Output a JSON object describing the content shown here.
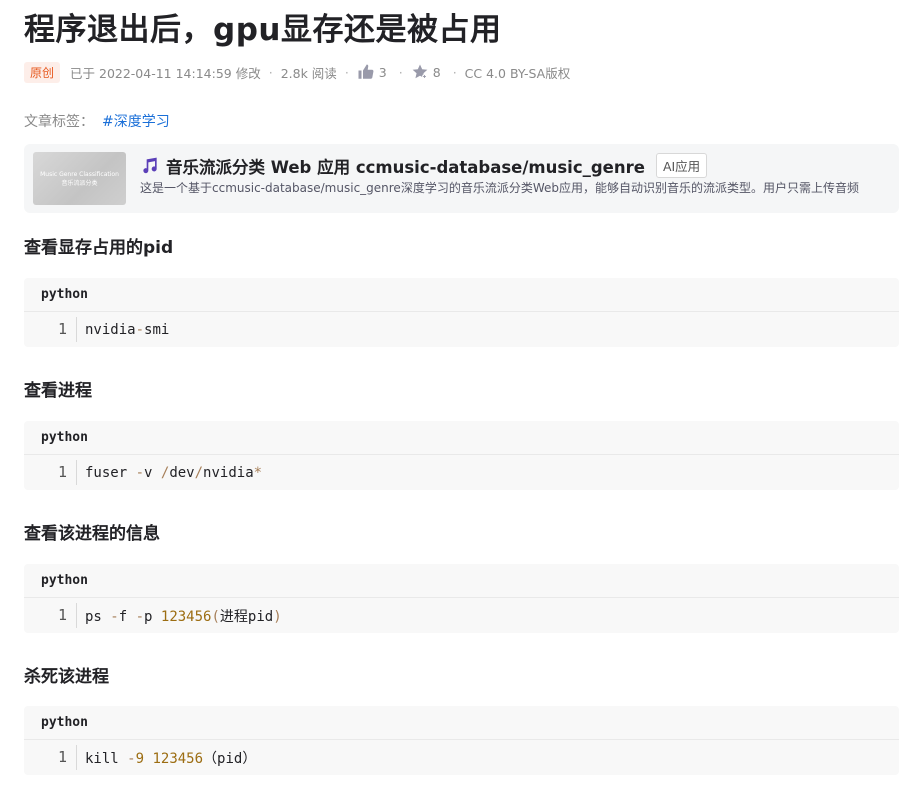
{
  "article": {
    "title": "程序退出后，gpu显存还是被占用",
    "meta": {
      "badge": "原创",
      "modified": "已于 2022-04-11 14:14:59 修改",
      "views": "2.8k 阅读",
      "likes": "3",
      "favorites": "8",
      "license": "CC 4.0 BY-SA版权"
    },
    "tags_label": "文章标签：",
    "tags": [
      "#深度学习"
    ]
  },
  "promo_card": {
    "thumb_text": [
      "Music Genre Classification",
      "音乐流派分类"
    ],
    "title": "音乐流派分类 Web 应用 ccmusic-database/music_genre",
    "badge": "AI应用",
    "description": "这是一个基于ccmusic-database/music_genre深度学习的音乐流派分类Web应用，能够自动识别音乐的流派类型。用户只需上传音频"
  },
  "sections": [
    {
      "heading": "查看显存占用的pid",
      "code": {
        "lang": "python",
        "line_no": "1",
        "tokens": [
          {
            "t": "nvidia",
            "c": "plain"
          },
          {
            "t": "-",
            "c": "op"
          },
          {
            "t": "smi",
            "c": "plain"
          }
        ]
      }
    },
    {
      "heading": "查看进程",
      "code": {
        "lang": "python",
        "line_no": "1",
        "tokens": [
          {
            "t": "fuser ",
            "c": "plain"
          },
          {
            "t": "-",
            "c": "op"
          },
          {
            "t": "v ",
            "c": "plain"
          },
          {
            "t": "/",
            "c": "op"
          },
          {
            "t": "dev",
            "c": "plain"
          },
          {
            "t": "/",
            "c": "op"
          },
          {
            "t": "nvidia",
            "c": "plain"
          },
          {
            "t": "*",
            "c": "op"
          }
        ]
      }
    },
    {
      "heading": "查看该进程的信息",
      "code": {
        "lang": "python",
        "line_no": "1",
        "tokens": [
          {
            "t": "ps ",
            "c": "plain"
          },
          {
            "t": "-",
            "c": "op"
          },
          {
            "t": "f ",
            "c": "plain"
          },
          {
            "t": "-",
            "c": "op"
          },
          {
            "t": "p ",
            "c": "plain"
          },
          {
            "t": "123456",
            "c": "num"
          },
          {
            "t": "(",
            "c": "op"
          },
          {
            "t": "进程pid",
            "c": "plain"
          },
          {
            "t": ")",
            "c": "op"
          }
        ]
      }
    },
    {
      "heading": "杀死该进程",
      "code": {
        "lang": "python",
        "line_no": "1",
        "tokens": [
          {
            "t": "kill ",
            "c": "plain"
          },
          {
            "t": "-",
            "c": "op"
          },
          {
            "t": "9",
            "c": "num"
          },
          {
            "t": " ",
            "c": "plain"
          },
          {
            "t": "123456",
            "c": "num"
          },
          {
            "t": "（pid）",
            "c": "plain"
          }
        ]
      }
    }
  ],
  "colors": {
    "badge_bg": "#fdeee9",
    "badge_fg": "#e7591f",
    "link": "#1a6fd8",
    "code_bg": "#f8f8f8",
    "number_token": "#9c6d12"
  },
  "icons": {
    "likes": "thumbs-up-icon",
    "favorites": "star-icon",
    "card": "music-note-icon"
  }
}
